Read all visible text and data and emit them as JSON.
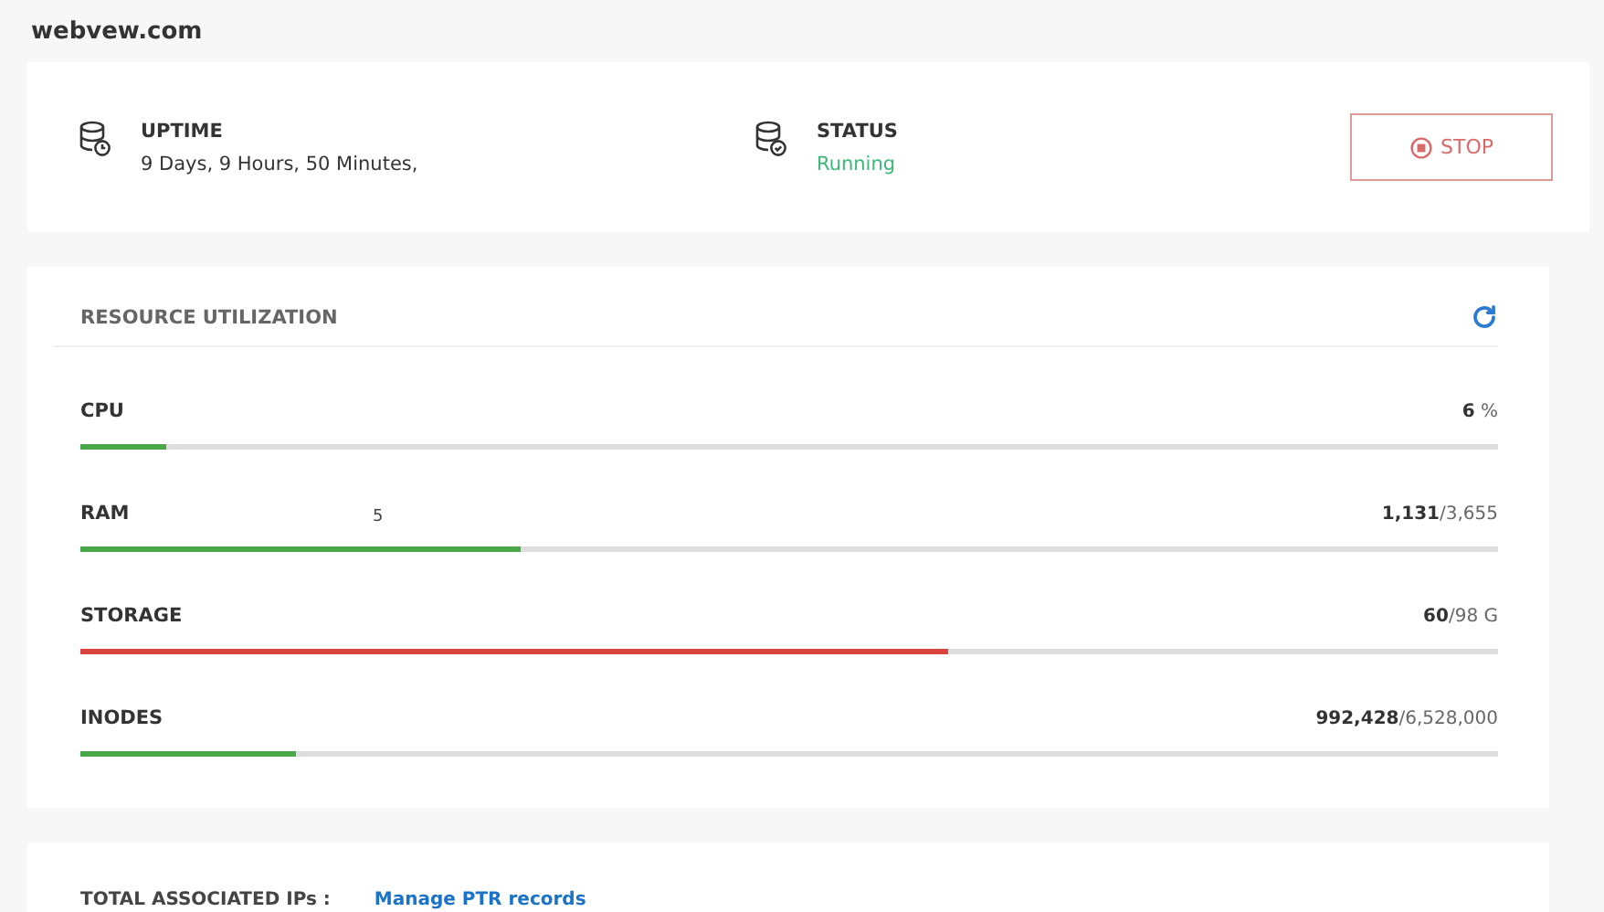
{
  "page_title": "webvew.com",
  "summary": {
    "uptime": {
      "label": "UPTIME",
      "value": "9 Days, 9 Hours, 50 Minutes,"
    },
    "status": {
      "label": "STATUS",
      "value": "Running",
      "running": true
    },
    "stop_button": "STOP"
  },
  "resources": {
    "title": "RESOURCE UTILIZATION",
    "items": [
      {
        "name": "CPU",
        "reading": "**6** %",
        "level": 0.06,
        "color": "#4aa84a"
      },
      {
        "name": "RAM",
        "note": "5",
        "reading": "**1,131**/3,655",
        "level": 0.31,
        "color": "#4aa84a"
      },
      {
        "name": "STORAGE",
        "reading": "**60**/98 G",
        "level": 0.612,
        "color": "#d9443f"
      },
      {
        "name": "INODES",
        "reading": "**992,428**/6,528,000",
        "level": 0.152,
        "color": "#4aa84a"
      }
    ]
  },
  "ips": {
    "label": "TOTAL ASSOCIATED IPs :",
    "link": "Manage PTR records"
  }
}
